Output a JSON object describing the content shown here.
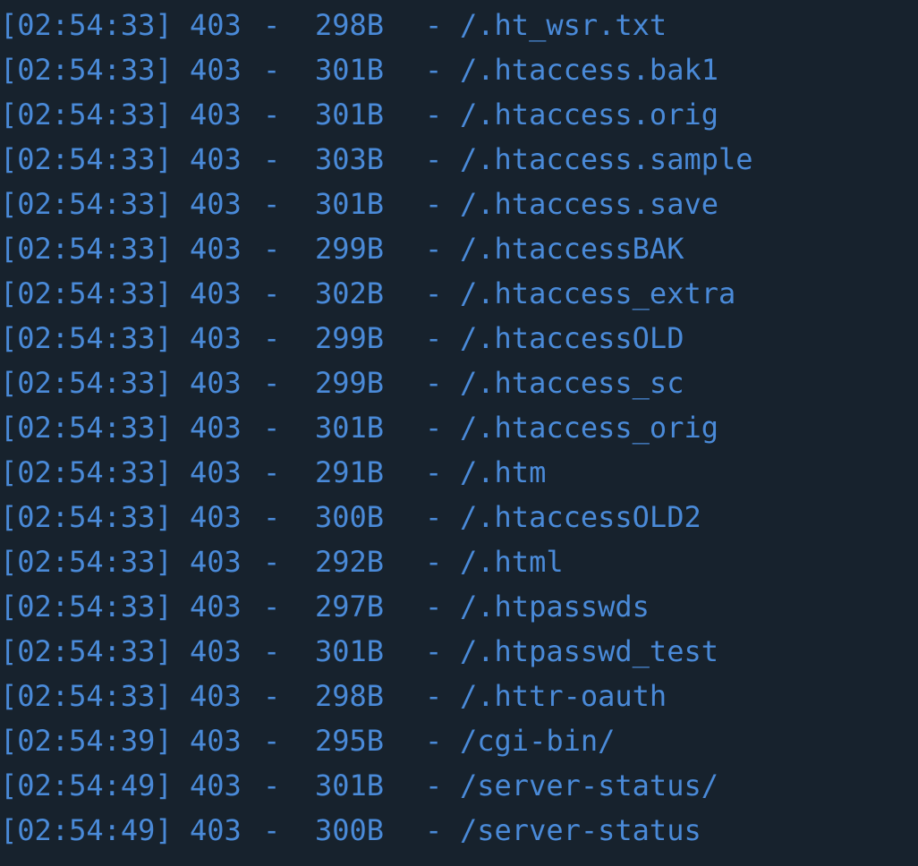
{
  "theme": {
    "background": "#17222d",
    "text_color": "#4a8ad8"
  },
  "terminal": {
    "separator": "-",
    "lines": [
      {
        "time": "[02:54:33]",
        "status": "403",
        "size": "298B",
        "path": "/.ht_wsr.txt"
      },
      {
        "time": "[02:54:33]",
        "status": "403",
        "size": "301B",
        "path": "/.htaccess.bak1"
      },
      {
        "time": "[02:54:33]",
        "status": "403",
        "size": "301B",
        "path": "/.htaccess.orig"
      },
      {
        "time": "[02:54:33]",
        "status": "403",
        "size": "303B",
        "path": "/.htaccess.sample"
      },
      {
        "time": "[02:54:33]",
        "status": "403",
        "size": "301B",
        "path": "/.htaccess.save"
      },
      {
        "time": "[02:54:33]",
        "status": "403",
        "size": "299B",
        "path": "/.htaccessBAK"
      },
      {
        "time": "[02:54:33]",
        "status": "403",
        "size": "302B",
        "path": "/.htaccess_extra"
      },
      {
        "time": "[02:54:33]",
        "status": "403",
        "size": "299B",
        "path": "/.htaccessOLD"
      },
      {
        "time": "[02:54:33]",
        "status": "403",
        "size": "299B",
        "path": "/.htaccess_sc"
      },
      {
        "time": "[02:54:33]",
        "status": "403",
        "size": "301B",
        "path": "/.htaccess_orig"
      },
      {
        "time": "[02:54:33]",
        "status": "403",
        "size": "291B",
        "path": "/.htm"
      },
      {
        "time": "[02:54:33]",
        "status": "403",
        "size": "300B",
        "path": "/.htaccessOLD2"
      },
      {
        "time": "[02:54:33]",
        "status": "403",
        "size": "292B",
        "path": "/.html"
      },
      {
        "time": "[02:54:33]",
        "status": "403",
        "size": "297B",
        "path": "/.htpasswds"
      },
      {
        "time": "[02:54:33]",
        "status": "403",
        "size": "301B",
        "path": "/.htpasswd_test"
      },
      {
        "time": "[02:54:33]",
        "status": "403",
        "size": "298B",
        "path": "/.httr-oauth"
      },
      {
        "time": "[02:54:39]",
        "status": "403",
        "size": "295B",
        "path": "/cgi-bin/"
      },
      {
        "time": "[02:54:49]",
        "status": "403",
        "size": "301B",
        "path": "/server-status/"
      },
      {
        "time": "[02:54:49]",
        "status": "403",
        "size": "300B",
        "path": "/server-status"
      }
    ]
  }
}
